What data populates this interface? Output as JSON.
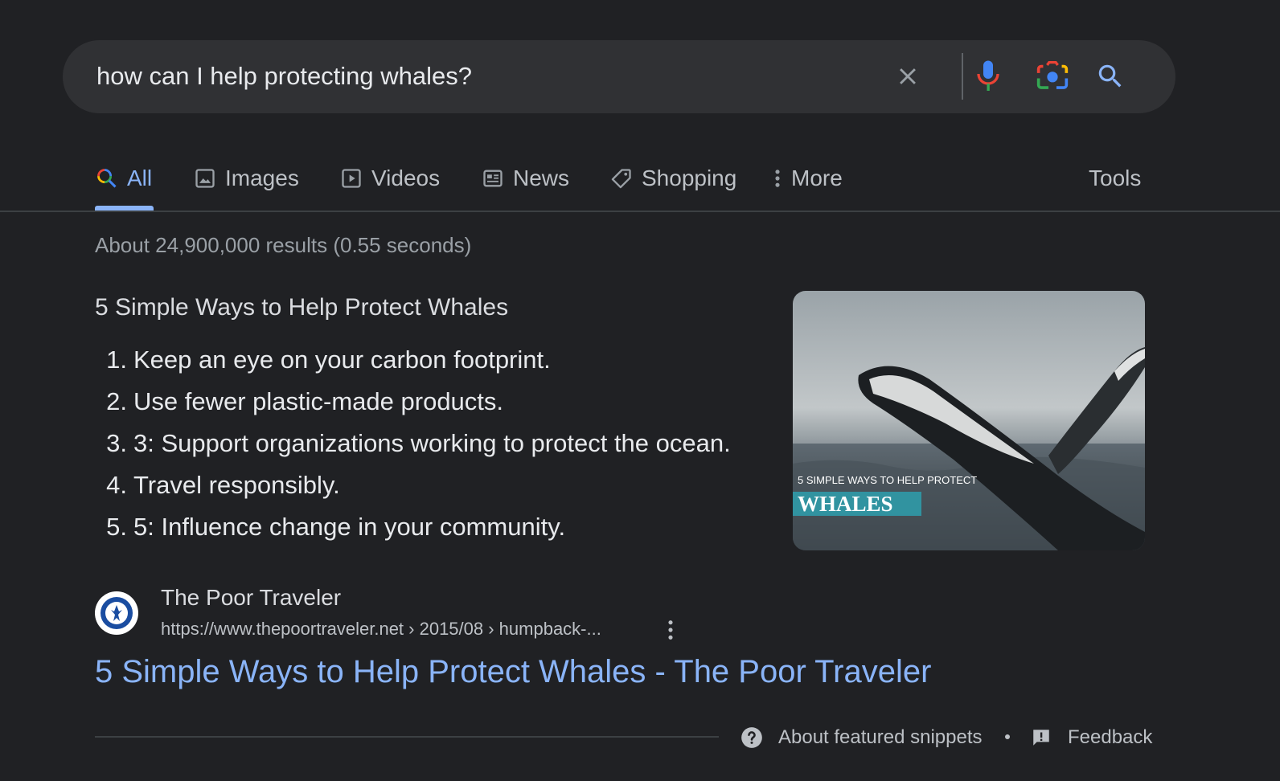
{
  "search": {
    "query": "how can I help protecting whales?"
  },
  "icons": {
    "clear": "close-icon",
    "voice": "mic-icon",
    "lens": "camera-icon",
    "search": "search-icon"
  },
  "tabs": [
    {
      "label": "All",
      "icon": "search-icon",
      "active": true
    },
    {
      "label": "Images",
      "icon": "image-icon"
    },
    {
      "label": "Videos",
      "icon": "play-icon"
    },
    {
      "label": "News",
      "icon": "newspaper-icon"
    },
    {
      "label": "Shopping",
      "icon": "tag-icon"
    },
    {
      "label": "More",
      "icon": "more-vertical-icon"
    }
  ],
  "tools_label": "Tools",
  "result_stats": "About 24,900,000 results (0.55 seconds)",
  "snippet": {
    "title": "5 Simple Ways to Help Protect Whales",
    "items": [
      {
        "num": "1.",
        "text": "Keep an eye on your carbon footprint."
      },
      {
        "num": "2.",
        "text": "Use fewer plastic-made products."
      },
      {
        "num": "3.",
        "text": "3: Support organizations working to protect the ocean."
      },
      {
        "num": "4.",
        "text": "Travel responsibly."
      },
      {
        "num": "5.",
        "text": "5: Influence change in your community."
      }
    ],
    "image_caption_small": "5 SIMPLE WAYS TO HELP PROTECT",
    "image_caption_big": "WHALES"
  },
  "source": {
    "name": "The Poor Traveler",
    "url": "https://www.thepoortraveler.net › 2015/08 › humpback-...",
    "link_title": "5 Simple Ways to Help Protect Whales - The Poor Traveler"
  },
  "footer": {
    "about": "About featured snippets",
    "feedback": "Feedback"
  },
  "colors": {
    "background": "#202124",
    "link": "#8ab4f8",
    "text": "#e8eaed"
  }
}
